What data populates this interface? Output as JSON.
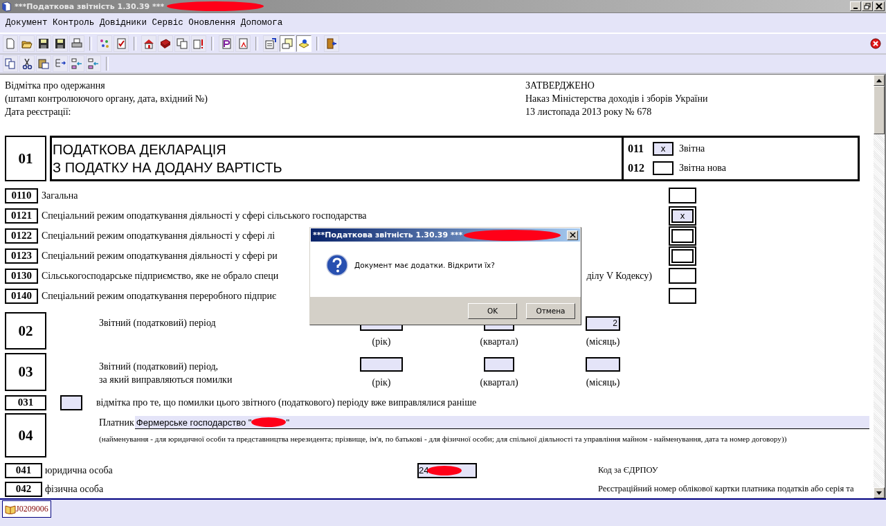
{
  "window": {
    "title": "***Податкова звітність 1.30.39 ***"
  },
  "menu": [
    "Документ",
    "Контроль",
    "Довідники",
    "Сервіс",
    "Оновлення",
    "Допомога"
  ],
  "form": {
    "receipt_note": [
      "Відмітка про одержання",
      "(штамп контролюючого органу, дата, вхідний №)",
      "Дата реєстрації:"
    ],
    "approval": [
      "ЗАТВЕРДЖЕНО",
      "Наказ Міністерства доходів і зборів України",
      "13 листопада 2013 року № 678"
    ],
    "section_01": {
      "code": "01",
      "title": [
        "ПОДАТКОВА ДЕКЛАРАЦІЯ",
        "З ПОДАТКУ НА ДОДАНУ ВАРТІСТЬ"
      ],
      "types": [
        {
          "code": "011",
          "label": "Звітна",
          "checked": true,
          "mark": "x"
        },
        {
          "code": "012",
          "label": "Звітна нова",
          "checked": false
        }
      ]
    },
    "options": [
      {
        "code": "0110",
        "label": "Загальна",
        "checked": false,
        "kind": "single"
      },
      {
        "code": "0121",
        "label": "Спеціальний режим оподаткування діяльності у сфері сільського господарства",
        "checked": true,
        "mark": "x",
        "kind": "double"
      },
      {
        "code": "0122",
        "label": "Спеціальний режим оподаткування діяльності у сфері лі",
        "checked": false,
        "kind": "double"
      },
      {
        "code": "0123",
        "label": "Спеціальний режим оподаткування діяльності у сфері ри",
        "checked": false,
        "kind": "double"
      },
      {
        "code": "0130",
        "label": "Сільськогосподарське підприємство, яке не обрало специ",
        "tail": "ділу V Кодексу)",
        "checked": false,
        "kind": "single"
      },
      {
        "code": "0140",
        "label": "Спеціальний режим оподаткування переробного підприє",
        "checked": false,
        "kind": "single"
      }
    ],
    "periods": [
      {
        "code": "02",
        "label": [
          "Звітний (податковий) період"
        ],
        "fields": [
          {
            "caption": "(рік)"
          },
          {
            "caption": "(квартал)"
          },
          {
            "value": "2",
            "caption": "(місяць)"
          }
        ]
      },
      {
        "code": "03",
        "label": [
          "Звітний (податковий) період,",
          "за який виправляються помилки"
        ],
        "fields": [
          {
            "caption": "(рік)"
          },
          {
            "caption": "(квартал)"
          },
          {
            "caption": "(місяць)"
          }
        ]
      }
    ],
    "correction": {
      "code": "031",
      "checked": false,
      "label": "відмітка про те, що помилки цього звітного (податкового) періоду вже виправлялися раніше"
    },
    "payer": {
      "code": "04",
      "label": "Платник",
      "value": "Фермерське господарство \"",
      "value_tail": "\"",
      "note": "(найменування - для юридичної особи та представництва нерезидента; прізвище, ім'я, по батькові - для фізичної особи; для спільної діяльності та управління майном - найменування, дата та номер договору))"
    },
    "entities": [
      {
        "code": "041",
        "label": "юридична особа",
        "value": "24",
        "right_label": "Код за ЄДРПОУ"
      },
      {
        "code": "042",
        "label": "фізична особа",
        "right_label": "Реєстраційний номер облікової картки платника податків або серія та"
      }
    ]
  },
  "document_tabs": [
    {
      "label": "J0209006",
      "selected": true
    }
  ],
  "dialog": {
    "title": "***Податкова звітність 1.30.39 ***",
    "message": "Документ має додатки. Відкрити їх?",
    "buttons": [
      "OK",
      "Отмена"
    ]
  }
}
